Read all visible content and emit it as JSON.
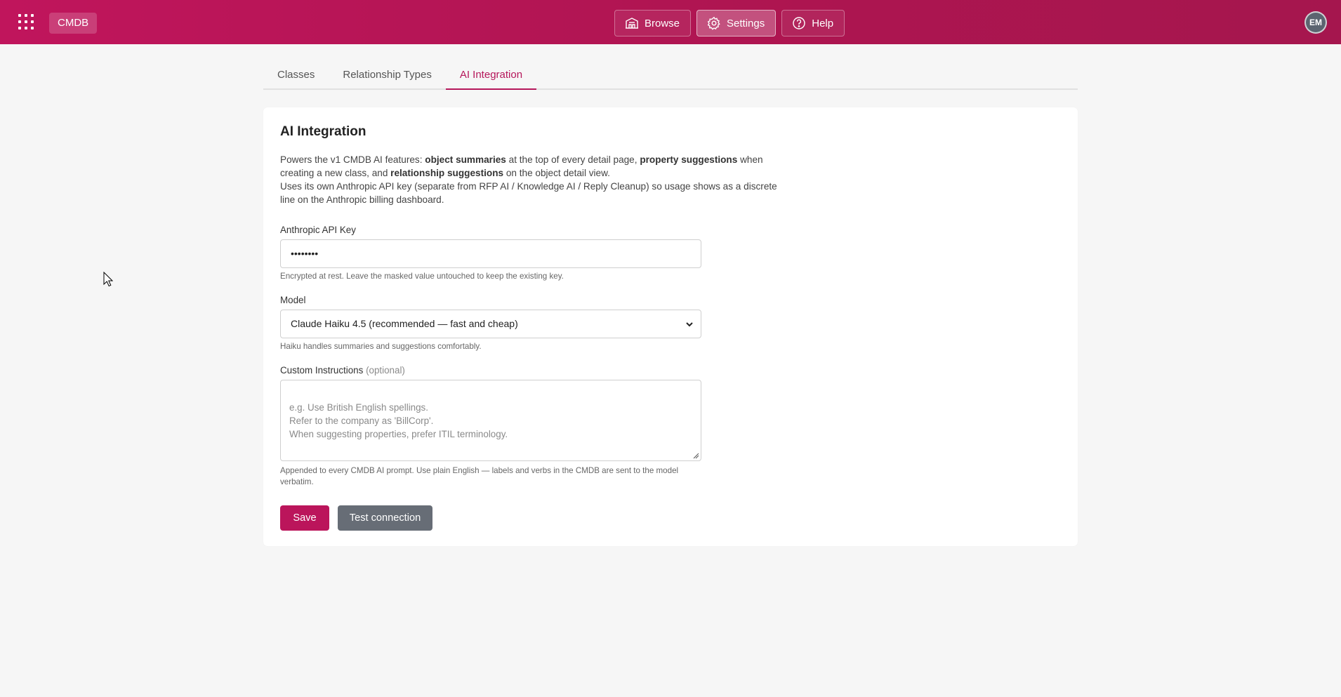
{
  "topbar": {
    "brand": "CMDB",
    "nav": [
      {
        "label": "Browse",
        "icon": "building-icon",
        "active": false
      },
      {
        "label": "Settings",
        "icon": "gear-icon",
        "active": true
      },
      {
        "label": "Help",
        "icon": "help-circle-icon",
        "active": false
      }
    ],
    "avatar_initials": "EM",
    "accent_color": "#b5165a"
  },
  "tabs": [
    {
      "label": "Classes",
      "active": false
    },
    {
      "label": "Relationship Types",
      "active": false
    },
    {
      "label": "AI Integration",
      "active": true
    }
  ],
  "card": {
    "title": "AI Integration",
    "desc": {
      "p1_a": "Powers the v1 CMDB AI features: ",
      "p1_b": "object summaries",
      "p1_c": " at the top of every detail page, ",
      "p1_d": "property suggestions",
      "p1_e": " when creating a new class, and ",
      "p1_f": "relationship suggestions",
      "p1_g": " on the object detail view.",
      "p2": "Uses its own Anthropic API key (separate from RFP AI / Knowledge AI / Reply Cleanup) so usage shows as a discrete line on the Anthropic billing dashboard."
    },
    "api_key": {
      "label": "Anthropic API Key",
      "value": "••••••••",
      "help": "Encrypted at rest. Leave the masked value untouched to keep the existing key."
    },
    "model": {
      "label": "Model",
      "value": "Claude Haiku 4.5 (recommended — fast and cheap)",
      "help": "Haiku handles summaries and suggestions comfortably."
    },
    "instructions": {
      "label": "Custom Instructions",
      "optional": "(optional)",
      "placeholder": "e.g. Use British English spellings.\nRefer to the company as 'BillCorp'.\nWhen suggesting properties, prefer ITIL terminology.",
      "help": "Appended to every CMDB AI prompt. Use plain English — labels and verbs in the CMDB are sent to the model verbatim."
    },
    "save_label": "Save",
    "test_label": "Test connection"
  }
}
